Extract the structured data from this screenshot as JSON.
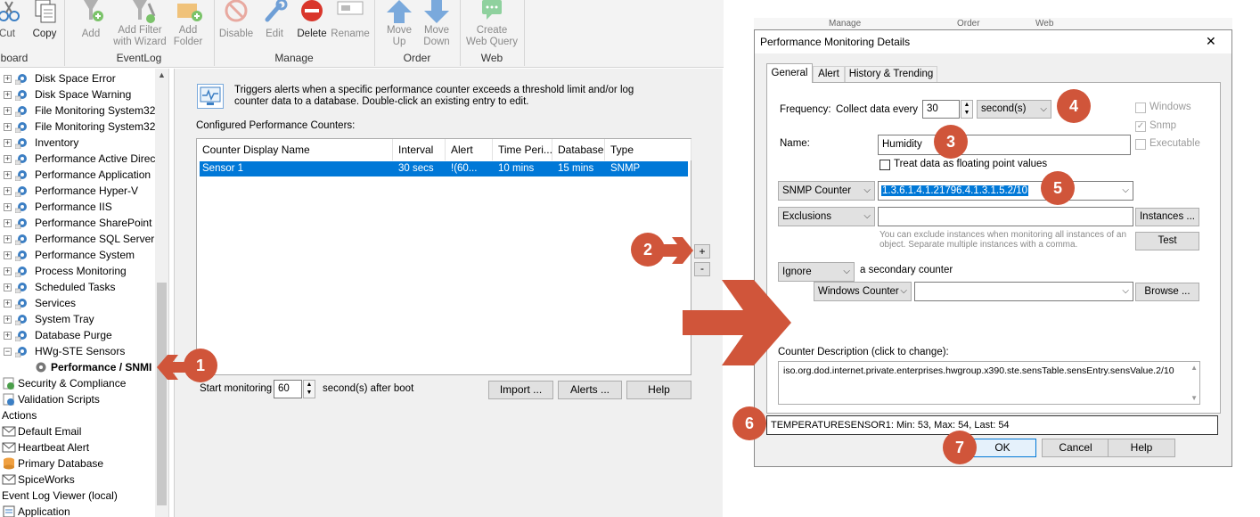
{
  "ribbon": {
    "cut": "Cut",
    "copy": "Copy",
    "clipboard_group": "board",
    "add": "Add",
    "add_filter_with_wizard": "Add Filter\nwith Wizard",
    "add_folder": "Add\nFolder",
    "eventlog_group": "EventLog",
    "disable": "Disable",
    "edit": "Edit",
    "delete": "Delete",
    "rename": "Rename",
    "manage_group": "Manage",
    "move_up": "Move\nUp",
    "move_down": "Move\nDown",
    "order_group": "Order",
    "create_web_query": "Create\nWeb Query",
    "web_group": "Web"
  },
  "tree": {
    "items": [
      "Disk Space Error",
      "Disk Space Warning",
      "File Monitoring System32",
      "File Monitoring System32",
      "Inventory",
      "Performance Active Direc",
      "Performance Application",
      "Performance Hyper-V",
      "Performance IIS",
      "Performance SharePoint",
      "Performance SQL Server",
      "Performance System",
      "Process Monitoring",
      "Scheduled Tasks",
      "Services",
      "System Tray",
      "Database Purge",
      "HWg-STE Sensors"
    ],
    "selected": "Performance / SNMI",
    "security": "Security & Compliance",
    "validation": "Validation Scripts",
    "actions_header": "Actions",
    "actions": [
      "Default Email",
      "Heartbeat Alert",
      "Primary Database",
      "SpiceWorks"
    ],
    "event_log_viewer": "Event Log Viewer (local)",
    "application": "Application"
  },
  "main": {
    "description": "Triggers alerts when a specific performance counter exceeds a threshold limit and/or log counter data to a database. Double-click an existing entry to edit.",
    "configured_label": "Configured Performance Counters:",
    "columns": [
      "Counter Display Name",
      "Interval",
      "Alert",
      "Time Peri...",
      "Database",
      "Type"
    ],
    "rows": [
      [
        "Sensor 1",
        "30 secs",
        "!(60...",
        "10 mins",
        "15 mins",
        "SNMP"
      ]
    ],
    "plus": "+",
    "minus": "-",
    "start_monitoring": "Start monitoring",
    "start_value": "60",
    "after_boot": "second(s) after boot",
    "import_btn": "Import ...",
    "alerts_btn": "Alerts ...",
    "help_btn": "Help"
  },
  "dialog": {
    "title": "Performance Monitoring Details",
    "close": "✕",
    "tabs": [
      "General",
      "Alert",
      "History & Trending"
    ],
    "frequency_label": "Frequency:",
    "collect_label": "Collect data every",
    "collect_value": "30",
    "unit": "second(s)",
    "name_label": "Name:",
    "name_value": "Humidity",
    "floating_point": "Treat data as floating point values",
    "counter_type": "SNMP Counter",
    "oid": "1.3.6.1.4.1.21796.4.1.3.1.5.2/10",
    "exclusions": "Exclusions",
    "exclusions_value": "",
    "instances_btn": "Instances ...",
    "exclusion_hint": "You can exclude instances when monitoring all instances of an object. Separate multiple instances with a comma.",
    "test_btn": "Test",
    "ignore": "Ignore",
    "secondary_label": "a secondary counter",
    "windows_counter": "Windows Counter",
    "secondary_value": "",
    "browse_btn": "Browse ...",
    "checkbox_windows": "Windows",
    "checkbox_snmp": "Snmp",
    "checkbox_executable": "Executable",
    "counter_desc_label": "Counter Description (click to change):",
    "counter_desc": "iso.org.dod.internet.private.enterprises.hwgroup.x390.ste.sensTable.sensEntry.sensValue.2/10",
    "status": "TEMPERATURESENSOR1: Min: 53, Max: 54, Last: 54",
    "ok_btn": "OK",
    "cancel_btn": "Cancel",
    "help_btn": "Help",
    "bg_tabs": [
      "Manage",
      "Order",
      "Web"
    ]
  },
  "badges": [
    "1",
    "2",
    "3",
    "4",
    "5",
    "6",
    "7"
  ],
  "colors": {
    "accent": "#d0553a",
    "selection": "#0078d7",
    "ribbon_blue": "#3c7fc4"
  }
}
